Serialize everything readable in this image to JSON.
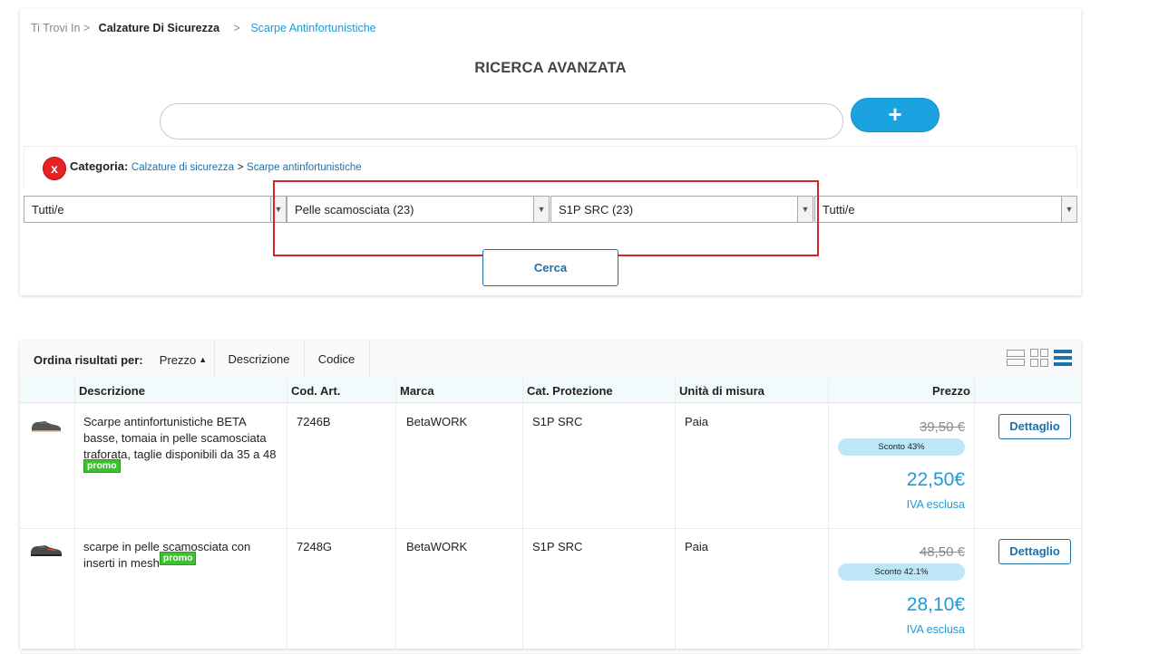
{
  "breadcrumb": {
    "prefix": "Ti Trovi In >",
    "level1": "Calzature Di Sicurezza",
    "sep": ">",
    "level2": "Scarpe Antinfortunistiche"
  },
  "search": {
    "title": "RICERCA AVANZATA",
    "value": "",
    "add_label": "+"
  },
  "category": {
    "remove_label": "x",
    "label": "Categoria:",
    "link1": "Calzature di sicurezza",
    "sep": ">",
    "link2": "Scarpe antinfortunistiche"
  },
  "filters": [
    {
      "value": "Tutti/e"
    },
    {
      "value": "Pelle scamosciata (23)"
    },
    {
      "value": "S1P SRC (23)"
    },
    {
      "value": "Tutti/e"
    }
  ],
  "cerca_label": "Cerca",
  "sort": {
    "label": "Ordina risultati per:",
    "options": [
      "Prezzo",
      "Descrizione",
      "Codice"
    ],
    "active_arrow": "▲"
  },
  "columns": [
    "Descrizione",
    "Cod. Art.",
    "Marca",
    "Cat. Protezione",
    "Unità di misura",
    "Prezzo"
  ],
  "products": [
    {
      "description": "Scarpe antinfortunistiche BETA basse, tomaia in pelle scamosciata traforata, taglie disponibili da 35 a 48",
      "promo": "promo",
      "code": "7246B",
      "brand": "BetaWORK",
      "protection": "S1P SRC",
      "unit": "Paia",
      "old_price": "39,50 €",
      "discount": "Sconto 43%",
      "price": "22,50€",
      "vat": "IVA esclusa",
      "detail_label": "Dettaglio"
    },
    {
      "description": "scarpe in pelle scamosciata con inserti in mesh",
      "promo": "promo",
      "code": "7248G",
      "brand": "BetaWORK",
      "protection": "S1P SRC",
      "unit": "Paia",
      "old_price": "48,50 €",
      "discount": "Sconto 42.1%",
      "price": "28,10€",
      "vat": "IVA esclusa",
      "detail_label": "Dettaglio"
    }
  ],
  "colors": {
    "accent": "#1aa3e0",
    "link": "#1f6fa8",
    "highlight_box": "#d42424",
    "promo": "#3cc12f"
  }
}
